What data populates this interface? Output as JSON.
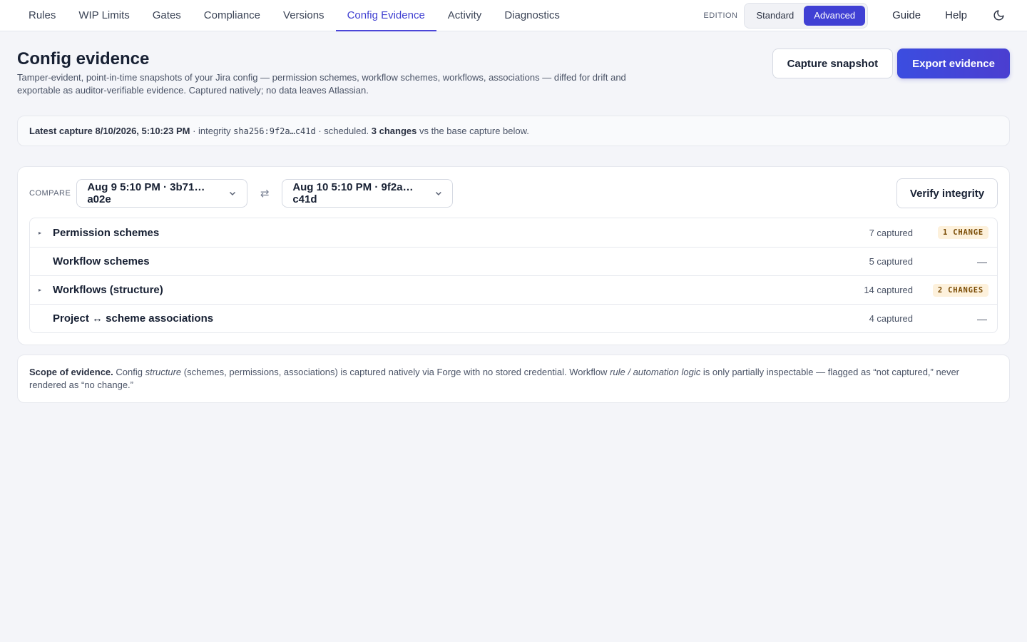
{
  "nav": {
    "tabs": [
      {
        "label": "Rules"
      },
      {
        "label": "WIP Limits"
      },
      {
        "label": "Gates"
      },
      {
        "label": "Compliance"
      },
      {
        "label": "Versions"
      },
      {
        "label": "Config Evidence",
        "active": true
      },
      {
        "label": "Activity"
      },
      {
        "label": "Diagnostics"
      }
    ],
    "edition_label": "EDITION",
    "edition_options": [
      "Standard",
      "Advanced"
    ],
    "edition_selected": "Advanced",
    "guide": "Guide",
    "help": "Help",
    "theme_icon": "moon-icon"
  },
  "header": {
    "title": "Config evidence",
    "description": "Tamper-evident, point-in-time snapshots of your Jira config — permission schemes, workflow schemes, workflows, associations — diffed for drift and exportable as auditor-verifiable evidence. Captured natively; no data leaves Atlassian.",
    "capture_button": "Capture snapshot",
    "export_button": "Export evidence"
  },
  "summary": {
    "latest": "Latest capture 8/10/2026, 5:10:23 PM",
    "integrity_prefix": " · integrity ",
    "hash": "sha256:9f2a…c41d",
    "mode": " · scheduled. ",
    "changes": "3 changes",
    "suffix": " vs the base capture below."
  },
  "compare": {
    "label": "COMPARE",
    "base": "Aug 9 5:10 PM · 3b71…a02e",
    "target": "Aug 10 5:10 PM · 9f2a…c41d",
    "swap_icon": "⇄",
    "verify_button": "Verify integrity",
    "rows": [
      {
        "name": "Permission schemes",
        "count": "7 captured",
        "status": "1 CHANGE",
        "expandable": true
      },
      {
        "name": "Workflow schemes",
        "count": "5 captured",
        "status": "—",
        "expandable": false
      },
      {
        "name": "Workflows (structure)",
        "count": "14 captured",
        "status": "2 CHANGES",
        "expandable": true
      },
      {
        "name": "Project ↔ scheme associations",
        "count": "4 captured",
        "status": "—",
        "expandable": false
      }
    ]
  },
  "scope": {
    "title": "Scope of evidence.",
    "t1": " Config ",
    "em1": "structure",
    "t2": " (schemes, permissions, associations) is captured natively via Forge with no stored credential. Workflow ",
    "em2": "rule / automation logic",
    "t3": " is only partially inspectable — flagged as “not captured,” never rendered as “no change.”"
  },
  "colors": {
    "accent": "#4040d4",
    "badge_bg": "#fdf1dc",
    "badge_text": "#7a4c05",
    "background": "#f4f5f9"
  }
}
